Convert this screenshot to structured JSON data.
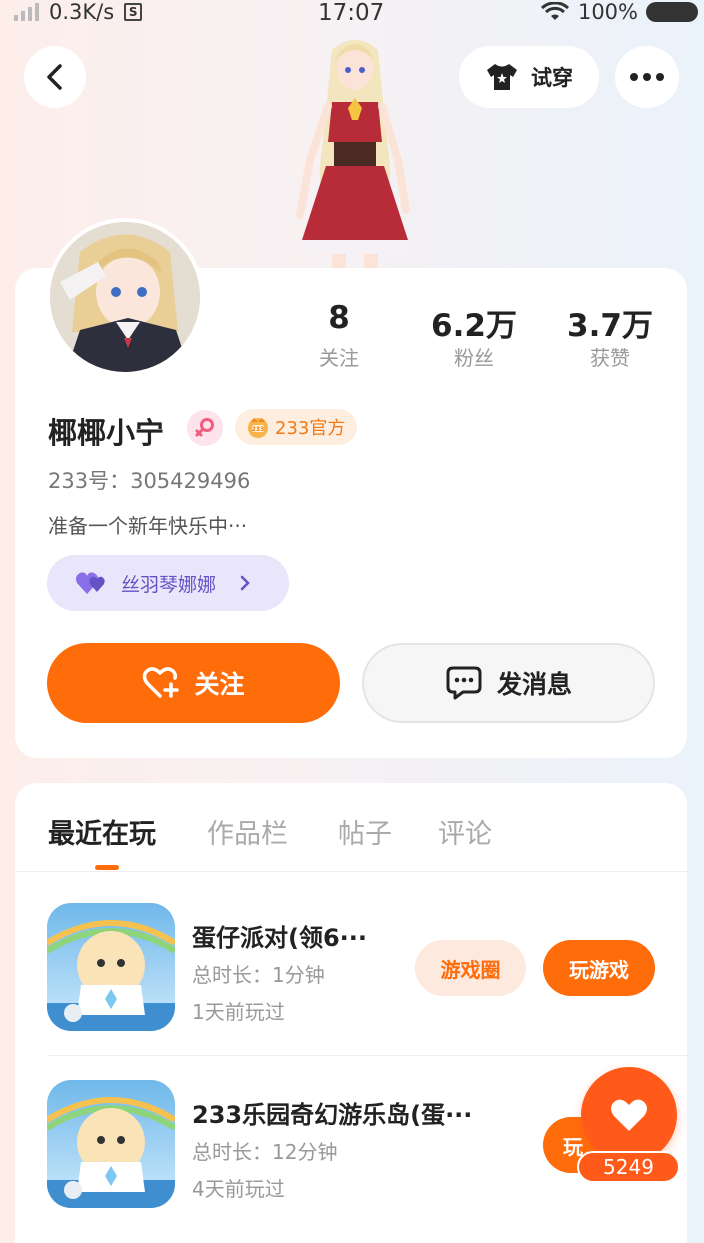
{
  "status_bar": {
    "net_speed": "0.3K/s",
    "sim_badge": "S",
    "time": "17:07",
    "battery": "100%"
  },
  "header": {
    "try_on_label": "试穿"
  },
  "profile": {
    "stats": [
      {
        "value": "8",
        "label": "关注"
      },
      {
        "value": "6.2万",
        "label": "粉丝"
      },
      {
        "value": "3.7万",
        "label": "获赞"
      }
    ],
    "name": "椰椰小宁",
    "gender_icon": "female-icon",
    "official_badge": "233官方",
    "uid": "233号：305429496",
    "bio": "准备一个新年快乐中···",
    "fan_tag": "丝羽琴娜娜",
    "follow_label": "关注",
    "message_label": "发消息"
  },
  "tabs": [
    "最近在玩",
    "作品栏",
    "帖子",
    "评论"
  ],
  "games": [
    {
      "title": "蛋仔派对(领6···",
      "duration": "总时长：1分钟",
      "last_played": "1天前玩过",
      "circle_label": "游戏圈",
      "play_label": "玩游戏"
    },
    {
      "title": "233乐园奇幻游乐岛(蛋···",
      "duration": "总时长：12分钟",
      "last_played": "4天前玩过",
      "play_label": "玩"
    }
  ],
  "float_like": {
    "count": "5249"
  },
  "colors": {
    "accent": "#ff6c0a",
    "fan_tag": "#6453c4",
    "official": "#f07a18"
  }
}
